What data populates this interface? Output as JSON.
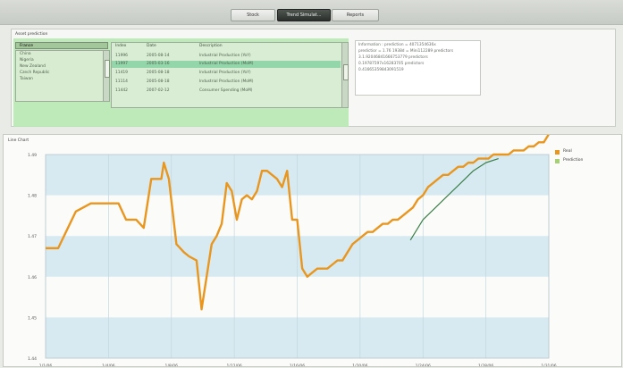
{
  "tabs": [
    {
      "label": "Stock"
    },
    {
      "label": "Trend Simulat..."
    },
    {
      "label": "Reports"
    }
  ],
  "panel": {
    "title": "Asset prediction",
    "combo_value": "France",
    "countries": [
      "China",
      "Nigeria",
      "New Zealand",
      "Czech Republic",
      "Taiwan"
    ],
    "table": {
      "headers": [
        "Index",
        "Date",
        "Description"
      ],
      "rows": [
        {
          "index": "11996",
          "date": "2005-08-14",
          "description": "Industrial Production (YoY)"
        },
        {
          "index": "11997",
          "date": "2005-03-16",
          "description": "Industrial Production (MoM)"
        },
        {
          "index": "11419",
          "date": "2005-08-18",
          "description": "Industrial Production (YoY)"
        },
        {
          "index": "11114",
          "date": "2005-08-18",
          "description": "Industrial Production (MoM)"
        },
        {
          "index": "11442",
          "date": "2007-02-12",
          "description": "Consumer Spending (MoM)"
        }
      ]
    },
    "results": "Information : prediction = 4071354636x\npredictior = 1.76 1938d = Mini112289 predictors\n3.1.92046841666753779 predictors\n0.19787597x16283705 predictors\n0.41665359843091519"
  },
  "chart_panel_title": "Line Chart",
  "chart_data": {
    "type": "line",
    "title": "",
    "xlabel": "",
    "ylabel": "",
    "ylim": [
      1.44,
      1.49
    ],
    "yticks": [
      "1.44",
      "1.45",
      "1.46",
      "1.47",
      "1.48",
      "1.49"
    ],
    "xticks": [
      "1/1/06",
      "1/4/06",
      "1/8/06",
      "1/12/06",
      "1/16/06",
      "1/20/06",
      "1/24/06",
      "1/28/06",
      "1/31/06"
    ],
    "grid": true,
    "legend": "right",
    "series": [
      {
        "name": "Real",
        "color": "#e9961f",
        "x": [
          0,
          0.05,
          0.12,
          0.18,
          0.22,
          0.26,
          0.29,
          0.32,
          0.36,
          0.39,
          0.42,
          0.44,
          0.46,
          0.47,
          0.49,
          0.52,
          0.55,
          0.57,
          0.6,
          0.62,
          0.66,
          0.68,
          0.7,
          0.72,
          0.74,
          0.76,
          0.78,
          0.8,
          0.82,
          0.84,
          0.86,
          0.88,
          0.9,
          0.92,
          0.94,
          0.96,
          0.98,
          1.0,
          1.02,
          1.04,
          1.06,
          1.08,
          1.1,
          1.12,
          1.14,
          1.16,
          1.18,
          1.2,
          1.22,
          1.24,
          1.26,
          1.28,
          1.3,
          1.32,
          1.34,
          1.36,
          1.38,
          1.4,
          1.42,
          1.44,
          1.46,
          1.48,
          1.5,
          1.52,
          1.54,
          1.56,
          1.58,
          1.6,
          1.62,
          1.64,
          1.66,
          1.68,
          1.7,
          1.72,
          1.74,
          1.76,
          1.78,
          1.8,
          1.82,
          1.84,
          1.86,
          1.88,
          1.9,
          1.92,
          1.94,
          1.96,
          1.98,
          2.0
        ],
        "values": [
          1.467,
          1.467,
          1.476,
          1.478,
          1.478,
          1.478,
          1.478,
          1.474,
          1.474,
          1.472,
          1.484,
          1.484,
          1.484,
          1.488,
          1.484,
          1.468,
          1.466,
          1.465,
          1.464,
          1.452,
          1.468,
          1.47,
          1.473,
          1.483,
          1.481,
          1.474,
          1.479,
          1.48,
          1.479,
          1.481,
          1.486,
          1.486,
          1.485,
          1.484,
          1.482,
          1.486,
          1.474,
          1.474,
          1.462,
          1.46,
          1.461,
          1.462,
          1.462,
          1.462,
          1.463,
          1.464,
          1.464,
          1.466,
          1.468,
          1.469,
          1.47,
          1.471,
          1.471,
          1.472,
          1.473,
          1.473,
          1.474,
          1.474,
          1.475,
          1.476,
          1.477,
          1.479,
          1.48,
          1.482,
          1.483,
          1.484,
          1.485,
          1.485,
          1.486,
          1.487,
          1.487,
          1.488,
          1.488,
          1.489,
          1.489,
          1.489,
          1.49,
          1.49,
          1.49,
          1.49,
          1.491,
          1.491,
          1.491,
          1.492,
          1.492,
          1.493,
          1.493,
          1.495
        ]
      },
      {
        "name": "Prediction",
        "color": "#3b7f48",
        "x": [
          1.45,
          1.5,
          1.55,
          1.6,
          1.65,
          1.7,
          1.75,
          1.8
        ],
        "values": [
          1.469,
          1.474,
          1.477,
          1.48,
          1.483,
          1.486,
          1.488,
          1.489
        ]
      }
    ]
  }
}
